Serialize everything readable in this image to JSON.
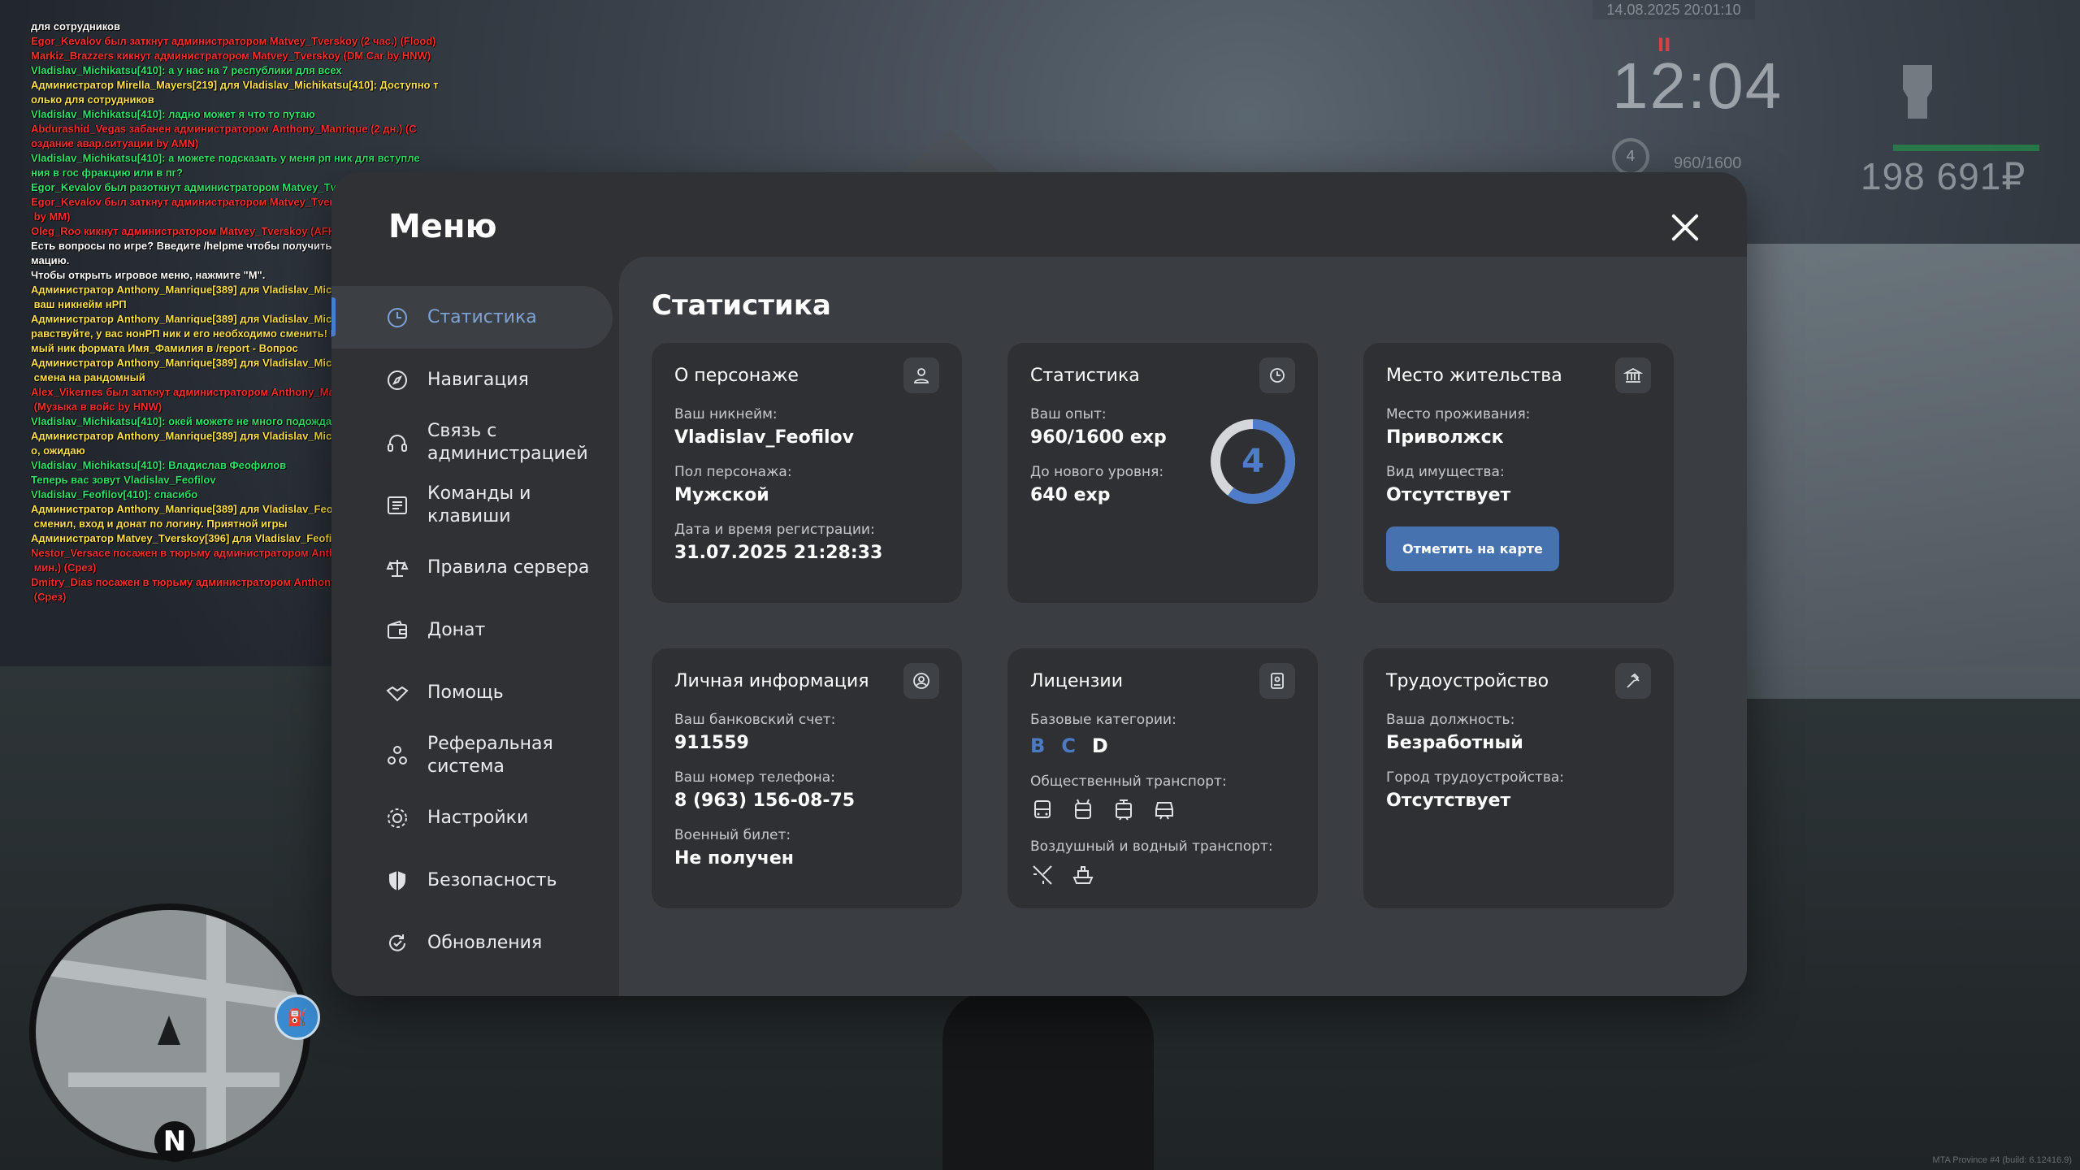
{
  "chat": [
    {
      "text": "для сотрудников",
      "color": "white"
    },
    {
      "text": "Egor_Kevalov был заткнут администратором Matvey_Tverskoy (2 час.) (Flood)",
      "color": "red"
    },
    {
      "text": "Markiz_Brazzers кикнут администратором Matvey_Tverskoy (DM Car by HNW)",
      "color": "red"
    },
    {
      "text": "Vladislav_Michikatsu[410]: а у нас на 7 республики для всех",
      "color": "green"
    },
    {
      "text": "Администратор Mirella_Mayers[219] для Vladislav_Michikatsu[410]: Доступно т",
      "color": "yellow"
    },
    {
      "text": "олько для сотрудников",
      "color": "yellow"
    },
    {
      "text": "Vladislav_Michikatsu[410]: ладно может я что то путаю",
      "color": "green"
    },
    {
      "text": "Abdurashid_Vegas забанен администратором Anthony_Manrique (2 дн.) (С",
      "color": "red"
    },
    {
      "text": "оздание авар.ситуации by AMN)",
      "color": "red"
    },
    {
      "text": "Vladislav_Michikatsu[410]: а можете подсказать у меня рп ник для вступле",
      "color": "green"
    },
    {
      "text": "ния в гос фракцию или в пг?",
      "color": "green"
    },
    {
      "text": "Egor_Kevalov был разоткнут администратором Matvey_Tverskoy.",
      "color": "green"
    },
    {
      "text": "Egor_Kevalov был заткнут администратором Matvey_Tverskoy (2 час.) (Flood",
      "color": "red"
    },
    {
      "text": " by MM)",
      "color": "red"
    },
    {
      "text": "Oleg_Roo кикнут администратором Matvey_Tverskoy (AFK 30",
      "color": "red"
    },
    {
      "text": "Есть вопросы по игре? Введите /helpme чтобы получить нужную инфор",
      "color": "white"
    },
    {
      "text": "мацию.",
      "color": "white"
    },
    {
      "text": "Чтобы открыть игровое меню, нажмите \"M\".",
      "color": "white"
    },
    {
      "text": "Администратор Anthony_Manrique[389] для Vladislav_Michikatsu[410]: Нет,",
      "color": "yellow"
    },
    {
      "text": " ваш никнейм нРП",
      "color": "yellow"
    },
    {
      "text": "Администратор Anthony_Manrique[389] для Vladislav_Michikatsu[410]: Зд",
      "color": "yellow"
    },
    {
      "text": "равствуйте, у вас нонРП ник и его необходимо сменить! Напишите желае",
      "color": "yellow"
    },
    {
      "text": "мый ник формата Имя_Фамилия в /report - Вопрос",
      "color": "yellow"
    },
    {
      "text": "Администратор Anthony_Manrique[389] для Vladislav_Michikatsu[410]: Игнор -",
      "color": "yellow"
    },
    {
      "text": " смена на рандомный",
      "color": "yellow"
    },
    {
      "text": "Alex_Vikernes был заткнут администратором Anthony_Manrique (1 час.)",
      "color": "red"
    },
    {
      "text": " (Музыка в войс by HNW)",
      "color": "red"
    },
    {
      "text": "Vladislav_Michikatsu[410]: окей можете не много подождать я придумаю",
      "color": "green"
    },
    {
      "text": "Администратор Anthony_Manrique[389] для Vladislav_Michikatsu[410]: Хорош",
      "color": "yellow"
    },
    {
      "text": "о, ожидаю",
      "color": "yellow"
    },
    {
      "text": "Vladislav_Michikatsu[410]: Владислав Феофилов",
      "color": "green"
    },
    {
      "text": "Теперь вас зовут Vladislav_Feofilov",
      "color": "green"
    },
    {
      "text": "Vladislav_Feofilov[410]: спасибо",
      "color": "green"
    },
    {
      "text": "Администратор Anthony_Manrique[389] для Vladislav_Feofilov[410]: Никнейм",
      "color": "yellow"
    },
    {
      "text": " сменил, вход и донат по логину. Приятной игры",
      "color": "yellow"
    },
    {
      "text": "Администратор Matvey_Tverskoy[396] для Vladislav_Feofilov[410]: )",
      "color": "yellow"
    },
    {
      "text": "Nestor_Versace посажен в тюрьму администратором Anthony_Manrique (30",
      "color": "red"
    },
    {
      "text": " мин.) (Срез)",
      "color": "red"
    },
    {
      "text": "Dmitry_Dias посажен в тюрьму администратором Anthony_Manrique (30 мин.)",
      "color": "red"
    },
    {
      "text": " (Срез)",
      "color": "red"
    }
  ],
  "hud": {
    "date": "14.08.2025 20:01:10",
    "pause": "II",
    "time": "12:04",
    "level": "4",
    "exp": "960/1600",
    "money": "198 691₽",
    "build": "MTA Province #4 (build: 6.12416.9)",
    "minimap_north": "N",
    "minimap_badge": "⛽"
  },
  "menu": {
    "title": "Меню",
    "nav": [
      {
        "label": "Статистика",
        "icon": "clock-icon",
        "active": true
      },
      {
        "label": "Навигация",
        "icon": "compass-icon"
      },
      {
        "label": "Связь с администрацией",
        "icon": "headset-icon"
      },
      {
        "label": "Команды и клавиши",
        "icon": "keyboard-icon"
      },
      {
        "label": "Правила сервера",
        "icon": "scales-icon"
      },
      {
        "label": "Донат",
        "icon": "wallet-icon"
      },
      {
        "label": "Помощь",
        "icon": "handshake-icon"
      },
      {
        "label": "Реферальная система",
        "icon": "people-icon"
      },
      {
        "label": "Настройки",
        "icon": "gear-icon"
      },
      {
        "label": "Безопасность",
        "icon": "shield-icon"
      },
      {
        "label": "Обновления",
        "icon": "refresh-icon"
      }
    ]
  },
  "content": {
    "title": "Статистика",
    "persona": {
      "title": "О персонаже",
      "nickname_label": "Ваш никнейм:",
      "nickname": "Vladislav_Feofilov",
      "gender_label": "Пол персонажа:",
      "gender": "Мужской",
      "reg_label": "Дата и время регистрации:",
      "reg": "31.07.2025 21:28:33"
    },
    "stats": {
      "title": "Статистика",
      "exp_label": "Ваш опыт:",
      "exp": "960/1600 exp",
      "next_label": "До нового уровня:",
      "next": "640 exp",
      "level": "4",
      "progress": 0.6
    },
    "residence": {
      "title": "Место жительства",
      "place_label": "Место проживания:",
      "place": "Приволжск",
      "property_label": "Вид имущества:",
      "property": "Отсутствует",
      "button": "Отметить на карте"
    },
    "personal": {
      "title": "Личная информация",
      "bank_label": "Ваш банковский счет:",
      "bank": "911559",
      "phone_label": "Ваш номер телефона:",
      "phone": "8 (963) 156-08-75",
      "military_label": "Военный билет:",
      "military": "Не получен"
    },
    "licenses": {
      "title": "Лицензии",
      "base_label": "Базовые категории:",
      "cat_b": "B",
      "cat_c": "C",
      "cat_d": "D",
      "public_label": "Общественный транспорт:",
      "air_label": "Воздушный и водный транспорт:"
    },
    "job": {
      "title": "Трудоустройство",
      "position_label": "Ваша должность:",
      "position": "Безработный",
      "city_label": "Город трудоустройства:",
      "city": "Отсутствует"
    }
  },
  "colors": {
    "accent": "#4d7ccd",
    "panel": "#2f3134",
    "card": "#2e3033"
  }
}
